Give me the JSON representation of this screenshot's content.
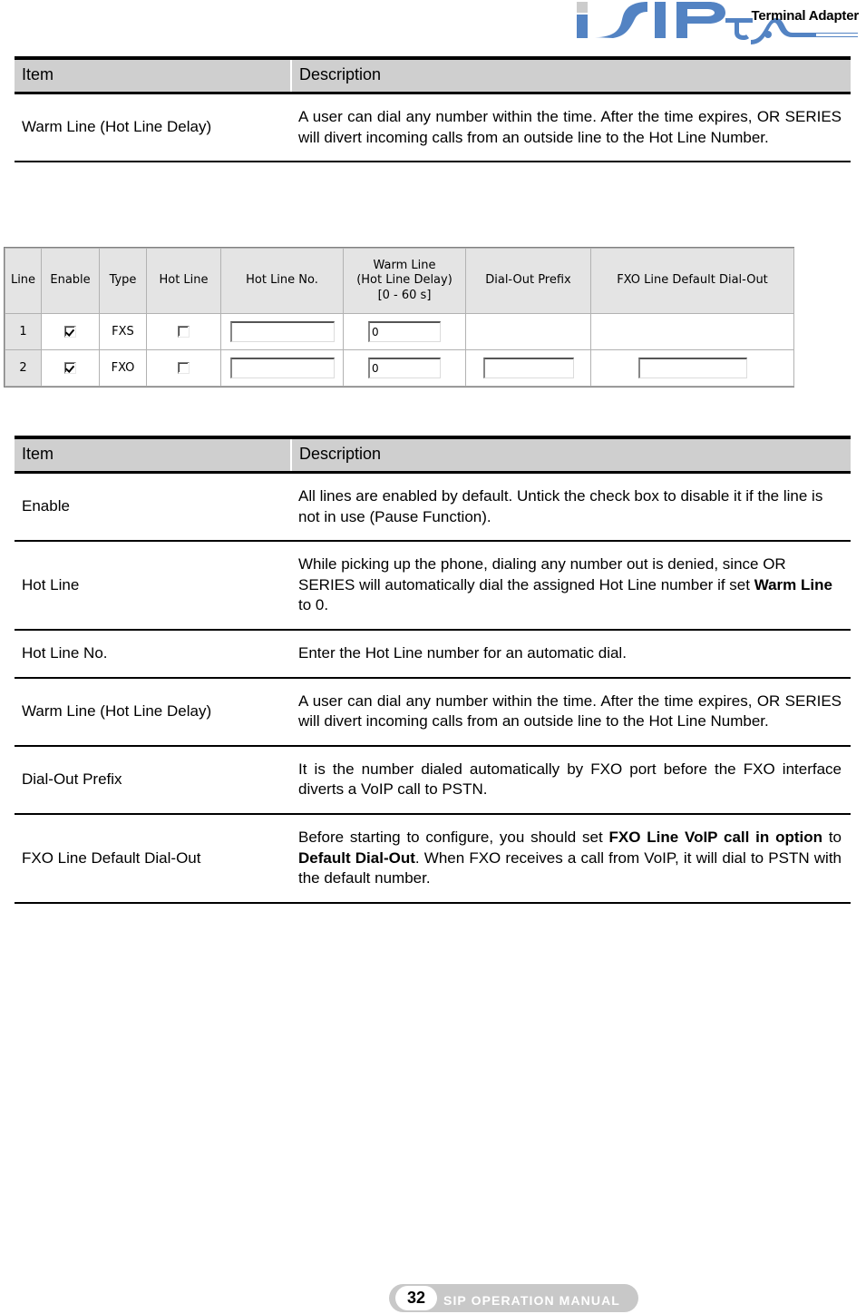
{
  "header": {
    "logo_text": "iSIP",
    "logo_sub": "TA",
    "product_title": "Terminal Adapter",
    "brand_blue": "#5383c3"
  },
  "table_one": {
    "headers": {
      "item": "Item",
      "description": "Description"
    },
    "rows": [
      {
        "item": "Warm Line (Hot Line Delay)",
        "desc_parts": [
          {
            "text": "A user can dial any number within the time. After the time expires, OR SERIES will divert incoming calls from an outside line to the Hot Line Number.",
            "bold": false
          }
        ]
      }
    ]
  },
  "form_screenshot": {
    "columns": [
      {
        "label": "Line"
      },
      {
        "label": "Enable"
      },
      {
        "label": "Type"
      },
      {
        "label": "Hot Line"
      },
      {
        "label": "Hot Line No."
      },
      {
        "label": "Warm Line",
        "line2": "(Hot Line Delay)",
        "line3": "[0 - 60 s]"
      },
      {
        "label": "Dial-Out Prefix"
      },
      {
        "label": "FXO Line Default Dial-Out"
      }
    ],
    "rows": [
      {
        "line": "1",
        "enable_checked": true,
        "type": "FXS",
        "hotline_checked": false,
        "hotline_no": "",
        "warm_line": "0",
        "dial_out_prefix": null,
        "fxo_default_dial_out": null
      },
      {
        "line": "2",
        "enable_checked": true,
        "type": "FXO",
        "hotline_checked": false,
        "hotline_no": "",
        "warm_line": "0",
        "dial_out_prefix": "",
        "fxo_default_dial_out": ""
      }
    ]
  },
  "table_two": {
    "headers": {
      "item": "Item",
      "description": "Description"
    },
    "rows": [
      {
        "item": "Enable",
        "desc_parts": [
          {
            "text": "All lines are enabled by default. Untick the check box to disable it if the line is not in use (Pause Function).",
            "bold": false
          }
        ]
      },
      {
        "item": "Hot Line",
        "desc_parts": [
          {
            "text": "While picking up the phone, dialing any number out is denied, since OR SERIES will automatically dial the assigned Hot Line number if set ",
            "bold": false
          },
          {
            "text": "Warm Line",
            "bold": true
          },
          {
            "text": " to 0.",
            "bold": false
          }
        ]
      },
      {
        "item": "Hot Line No.",
        "desc_parts": [
          {
            "text": "Enter the Hot Line number for an automatic dial.",
            "bold": false
          }
        ]
      },
      {
        "item": "Warm Line (Hot Line Delay)",
        "desc_parts": [
          {
            "text": "A user can dial any number within the time. After the time expires, OR SERIES will divert incoming calls from an outside line to the Hot Line Number.",
            "bold": false
          }
        ]
      },
      {
        "item": "Dial-Out Prefix",
        "desc_parts": [
          {
            "text": "It is the number dialed automatically by FXO port before the FXO interface diverts a VoIP call to PSTN.",
            "bold": false
          }
        ]
      },
      {
        "item": "FXO Line Default Dial-Out",
        "desc_parts": [
          {
            "text": "Before starting to configure, you should set ",
            "bold": false
          },
          {
            "text": "FXO Line VoIP call in option",
            "bold": true
          },
          {
            "text": " to ",
            "bold": false
          },
          {
            "text": "Default Dial-Out",
            "bold": true
          },
          {
            "text": ". When FXO receives a call from VoIP, it will dial to PSTN with the default number.",
            "bold": false
          }
        ]
      }
    ]
  },
  "footer": {
    "page_number": "32",
    "manual_label": "SIP OPERATION MANUAL"
  }
}
